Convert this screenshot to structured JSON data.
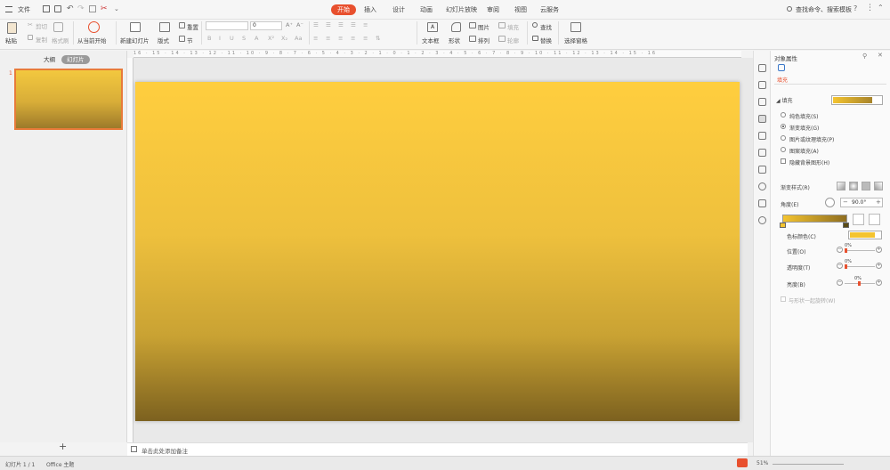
{
  "menu": {
    "file": "文件",
    "tabs": [
      "开始",
      "插入",
      "设计",
      "动画",
      "幻灯片放映",
      "审阅",
      "视图",
      "云服务"
    ],
    "active_tab": "开始",
    "search": "查找命令、搜索模板"
  },
  "ribbon": {
    "paste": "粘贴",
    "cut": "剪切",
    "copy": "复制",
    "format_painter": "格式刷",
    "play_from_current": "从当前开始",
    "new_slide": "新建幻灯片",
    "layout": "版式",
    "section": "节",
    "reset": "重置",
    "font_size": "0",
    "textbox": "文本框",
    "shape": "形状",
    "arrange": "排列",
    "picture": "图片",
    "fill": "填充",
    "outline": "轮廓",
    "find": "查找",
    "replace": "替换",
    "select_pane": "选择窗格"
  },
  "left_pane": {
    "tab_outline": "大纲",
    "tab_slides": "幻灯片",
    "slide_number": "1",
    "add": "+"
  },
  "ruler_text": "16 · 15 · 14 · 13 · 12 · 11 · 10 · 9 · 8 · 7 · 6 · 5 · 4 · 3 · 2 · 1 · 0 · 1 · 2 · 3 · 4 · 5 · 6 · 7 · 8 · 9 · 10 · 11 · 12 · 13 · 14 · 15 · 16",
  "notes": "单击此处添加备注",
  "status": {
    "slide_info": "幻灯片 1 / 1",
    "theme": "Office 主题",
    "zoom": "51%"
  },
  "panel": {
    "title": "对象属性",
    "tab_fill": "填充",
    "fill_label": "填充",
    "options": [
      "纯色填充(S)",
      "渐变填充(G)",
      "图片或纹理填充(P)",
      "图案填充(A)"
    ],
    "selected_option": 1,
    "hide_bg": "隐藏背景图形(H)",
    "gradient_style": "渐变样式(R)",
    "angle_label": "角度(E)",
    "angle_value": "90.0°",
    "stop_color": "色标颜色(C)",
    "position": "位置(O)",
    "transparency": "透明度(T)",
    "brightness": "亮度(B)",
    "rotate_with_shape": "与形状一起旋转(W)",
    "pct": "0%",
    "stop_position": 0,
    "stop_transparency": 0,
    "stop_brightness": 0
  },
  "colors": {
    "accent": "#e8502e",
    "fill_color": "#f4c430"
  }
}
